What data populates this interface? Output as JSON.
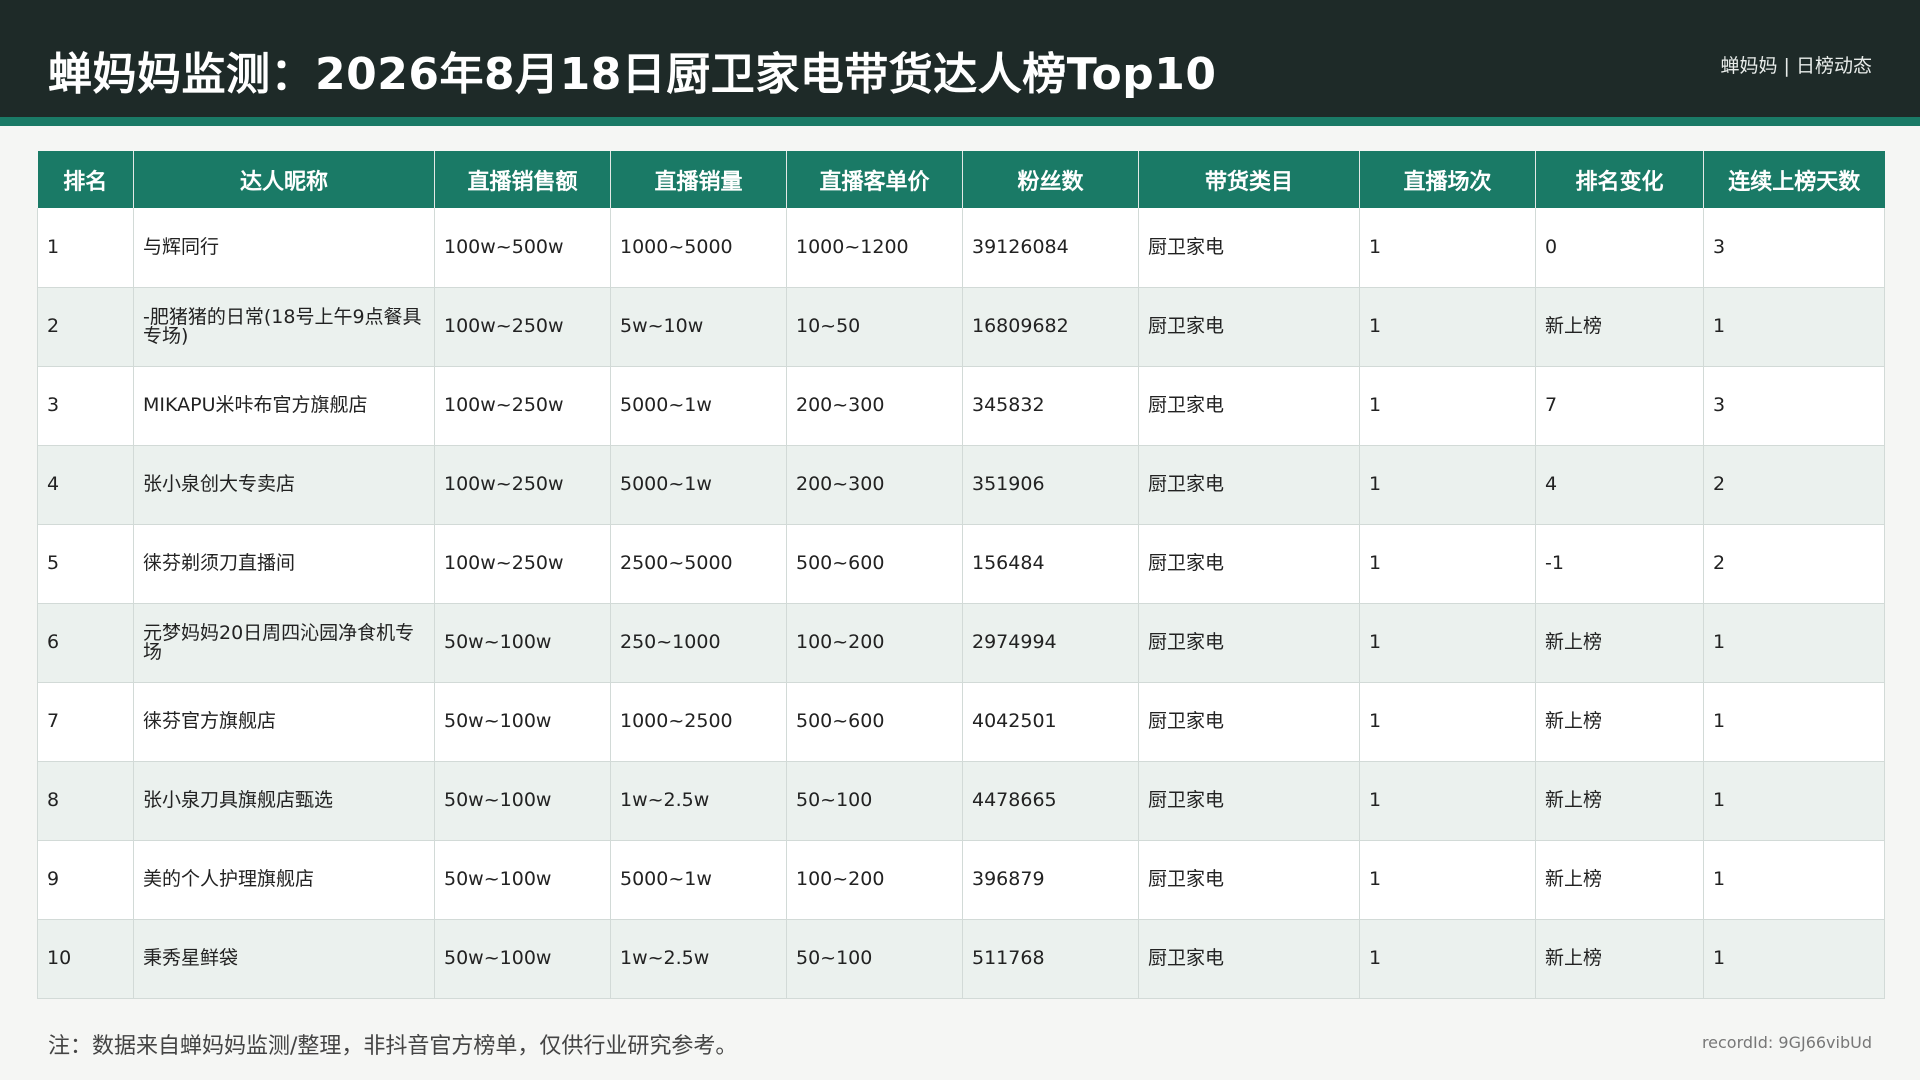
{
  "header": {
    "title": "蝉妈妈监测：2026年8月18日厨卫家电带货达人榜Top10",
    "brand": "蝉妈妈 | 日榜动态"
  },
  "table": {
    "columns": [
      "排名",
      "达人昵称",
      "直播销售额",
      "直播销量",
      "直播客单价",
      "粉丝数",
      "带货类目",
      "直播场次",
      "排名变化",
      "连续上榜天数"
    ],
    "rows": [
      [
        "1",
        "与辉同行",
        "100w~500w",
        "1000~5000",
        "1000~1200",
        "39126084",
        "厨卫家电",
        "1",
        "0",
        "3"
      ],
      [
        "2",
        "-肥猪猪的日常(18号上午9点餐具专场)",
        "100w~250w",
        "5w~10w",
        "10~50",
        "16809682",
        "厨卫家电",
        "1",
        "新上榜",
        "1"
      ],
      [
        "3",
        "MIKAPU米咔布官方旗舰店",
        "100w~250w",
        "5000~1w",
        "200~300",
        "345832",
        "厨卫家电",
        "1",
        "7",
        "3"
      ],
      [
        "4",
        "张小泉创大专卖店",
        "100w~250w",
        "5000~1w",
        "200~300",
        "351906",
        "厨卫家电",
        "1",
        "4",
        "2"
      ],
      [
        "5",
        "徕芬剃须刀直播间",
        "100w~250w",
        "2500~5000",
        "500~600",
        "156484",
        "厨卫家电",
        "1",
        "-1",
        "2"
      ],
      [
        "6",
        "元梦妈妈20日周四沁园净食机专场",
        "50w~100w",
        "250~1000",
        "100~200",
        "2974994",
        "厨卫家电",
        "1",
        "新上榜",
        "1"
      ],
      [
        "7",
        "徕芬官方旗舰店",
        "50w~100w",
        "1000~2500",
        "500~600",
        "4042501",
        "厨卫家电",
        "1",
        "新上榜",
        "1"
      ],
      [
        "8",
        "张小泉刀具旗舰店甄选",
        "50w~100w",
        "1w~2.5w",
        "50~100",
        "4478665",
        "厨卫家电",
        "1",
        "新上榜",
        "1"
      ],
      [
        "9",
        "美的个人护理旗舰店",
        "50w~100w",
        "5000~1w",
        "100~200",
        "396879",
        "厨卫家电",
        "1",
        "新上榜",
        "1"
      ],
      [
        "10",
        "秉秀星鲜袋",
        "50w~100w",
        "1w~2.5w",
        "50~100",
        "511768",
        "厨卫家电",
        "1",
        "新上榜",
        "1"
      ]
    ]
  },
  "footer": {
    "note": "注：数据来自蝉妈妈监测/整理，非抖音官方榜单，仅供行业研究参考。",
    "record_id": "recordId: 9GJ66vibUd"
  }
}
